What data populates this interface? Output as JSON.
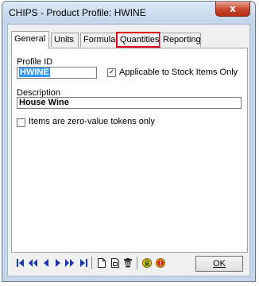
{
  "window": {
    "title": "CHIPS - Product Profile: HWINE",
    "close_glyph": "x"
  },
  "tabs": [
    {
      "label": "General"
    },
    {
      "label": "Units"
    },
    {
      "label": "Formulae"
    },
    {
      "label": "Quantities"
    },
    {
      "label": "Reporting"
    }
  ],
  "form": {
    "profile_id_label": "Profile ID",
    "profile_id_value": "HWINE",
    "stock_checkbox_label": "Applicable to Stock Items Only",
    "stock_checkbox_checked": true,
    "description_label": "Description",
    "description_value": "House Wine",
    "zero_value_label": "Items are zero-value tokens only",
    "zero_value_checked": false
  },
  "toolbar": {
    "ok_label": "OK",
    "icons": [
      "first-record-icon",
      "previous-page-icon",
      "previous-record-icon",
      "next-record-icon",
      "next-page-icon",
      "last-record-icon",
      "new-record-icon",
      "copy-record-icon",
      "delete-record-icon",
      "lock-icon",
      "alert-icon"
    ]
  },
  "colors": {
    "highlight": "#e0001b",
    "selection": "#3399ff",
    "nav_blue": "#1a35b0"
  }
}
